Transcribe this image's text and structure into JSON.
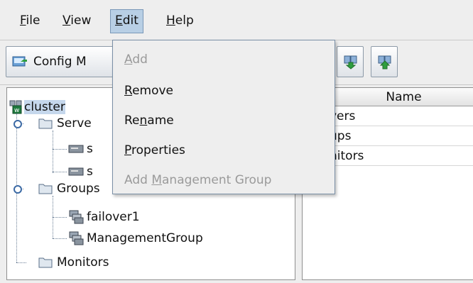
{
  "menubar": {
    "file": "File",
    "view": "View",
    "edit": "Edit",
    "help": "Help"
  },
  "toolbar": {
    "config_label": "Config M",
    "buttons": [
      "download-icon",
      "upload-icon"
    ]
  },
  "edit_menu": {
    "items": [
      {
        "label": "Add",
        "enabled": false
      },
      {
        "label": "Remove",
        "enabled": true
      },
      {
        "label": "Rename",
        "enabled": true
      },
      {
        "label": "Properties",
        "enabled": true
      },
      {
        "label": "Add Management Group",
        "enabled": false
      }
    ]
  },
  "tree": {
    "root": "cluster",
    "servers": "Serve",
    "server_1": "s",
    "server_2": "s",
    "groups": "Groups",
    "group_1": "failover1",
    "group_2": "ManagementGroup",
    "monitors": "Monitors"
  },
  "table": {
    "header": "Name",
    "rows": [
      "vers",
      "ups",
      "nitors"
    ]
  },
  "colors": {
    "menu_active_bg": "#b8cfe5",
    "selection_bg": "#c5d7ec",
    "disabled_text": "#9a9a9a",
    "folder_fill": "#dfe7ef"
  }
}
